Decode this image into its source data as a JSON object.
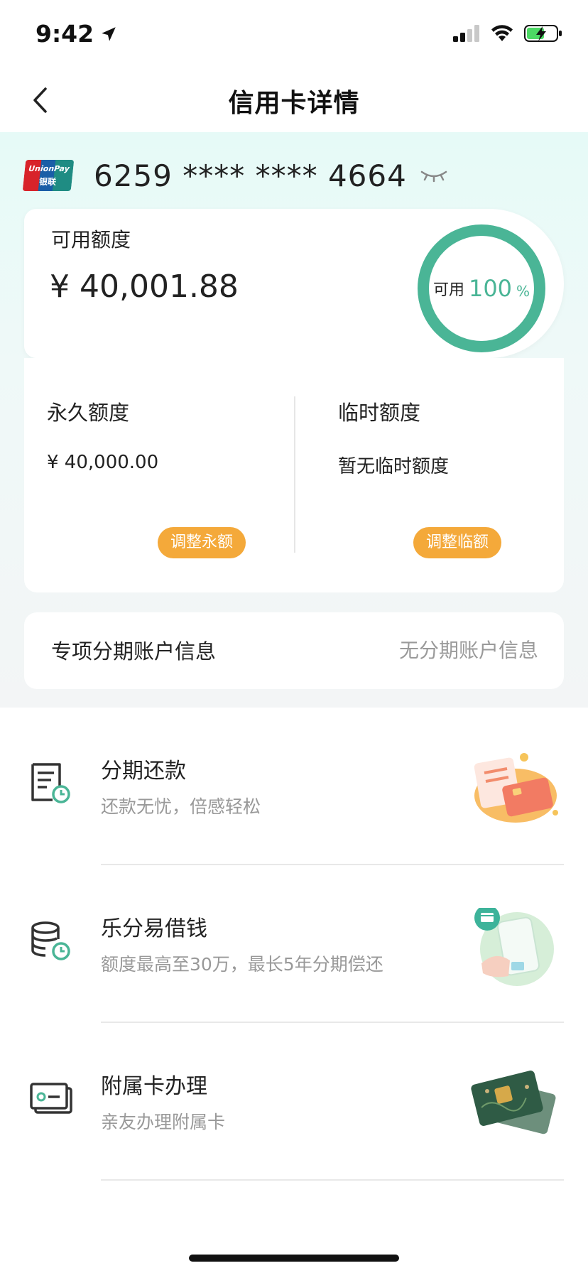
{
  "status_bar": {
    "time": "9:42"
  },
  "nav": {
    "title": "信用卡详情"
  },
  "card": {
    "brand_en": "UnionPay",
    "brand_cn": "银联",
    "number": "6259 **** **** 4664"
  },
  "available": {
    "label": "可用额度",
    "amount": "¥ 40,001.88",
    "ring_label": "可用",
    "ring_value": "100",
    "ring_unit": "%",
    "ring_percent": 100
  },
  "limits": {
    "permanent": {
      "title": "永久额度",
      "value": "¥ 40,000.00",
      "button": "调整永额"
    },
    "temporary": {
      "title": "临时额度",
      "value": "暂无临时额度",
      "button": "调整临额"
    }
  },
  "installment_account": {
    "title": "专项分期账户信息",
    "value": "无分期账户信息"
  },
  "services": [
    {
      "title": "分期还款",
      "subtitle": "还款无忧，倍感轻松",
      "icon": "bill-clock-icon"
    },
    {
      "title": "乐分易借钱",
      "subtitle": "额度最高至30万，最长5年分期偿还",
      "icon": "coins-clock-icon"
    },
    {
      "title": "附属卡办理",
      "subtitle": "亲友办理附属卡",
      "icon": "card-icon"
    }
  ],
  "colors": {
    "accent_green": "#4ab596",
    "button_orange": "#f4a93a",
    "muted_text": "#999999"
  }
}
